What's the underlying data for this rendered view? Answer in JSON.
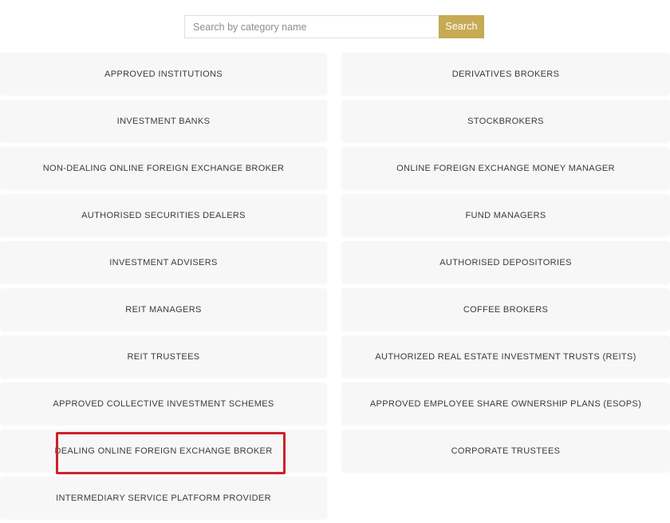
{
  "search": {
    "placeholder": "Search by category name",
    "value": "",
    "button_label": "Search",
    "button_color": "#c7aa54"
  },
  "categories": {
    "left_column": [
      {
        "label": "APPROVED INSTITUTIONS"
      },
      {
        "label": "INVESTMENT BANKS"
      },
      {
        "label": "NON-DEALING ONLINE FOREIGN EXCHANGE BROKER"
      },
      {
        "label": "AUTHORISED SECURITIES DEALERS"
      },
      {
        "label": "INVESTMENT ADVISERS"
      },
      {
        "label": "REIT MANAGERS"
      },
      {
        "label": "REIT TRUSTEES"
      },
      {
        "label": "APPROVED COLLECTIVE INVESTMENT SCHEMES"
      },
      {
        "label": "DEALING ONLINE FOREIGN EXCHANGE BROKER"
      },
      {
        "label": "INTERMEDIARY SERVICE PLATFORM PROVIDER"
      }
    ],
    "right_column": [
      {
        "label": "DERIVATIVES BROKERS"
      },
      {
        "label": "STOCKBROKERS"
      },
      {
        "label": "ONLINE FOREIGN EXCHANGE MONEY MANAGER"
      },
      {
        "label": "FUND MANAGERS"
      },
      {
        "label": "AUTHORISED DEPOSITORIES"
      },
      {
        "label": "COFFEE BROKERS"
      },
      {
        "label": "AUTHORIZED REAL ESTATE INVESTMENT TRUSTS (REITS)"
      },
      {
        "label": "APPROVED EMPLOYEE SHARE OWNERSHIP PLANS (ESOPS)"
      },
      {
        "label": "CORPORATE TRUSTEES"
      }
    ]
  },
  "annotation": {
    "highlighted_category": "DEALING ONLINE FOREIGN EXCHANGE BROKER",
    "border_color": "#cc2229"
  },
  "theme": {
    "page_background": "#ffffff",
    "tile_background": "#f7f7f8",
    "tile_text": "#3b3b3d",
    "accent": "#c7aa54"
  }
}
